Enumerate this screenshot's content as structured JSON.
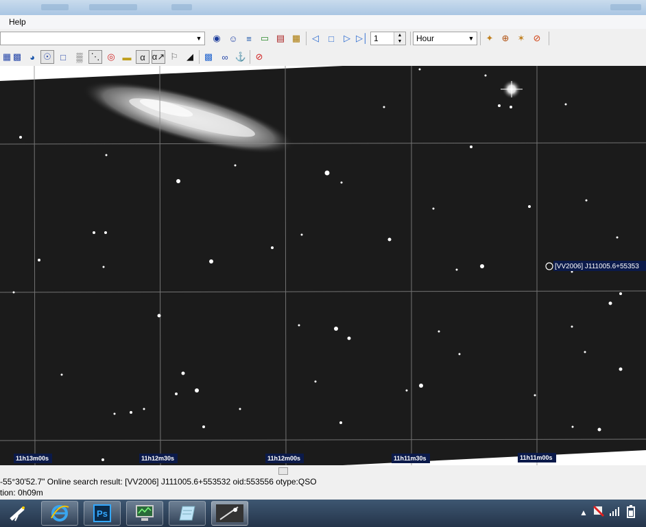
{
  "menu": {
    "help_label": "Help"
  },
  "toolbar": {
    "frame_value": "1",
    "time_unit": "Hour"
  },
  "sky": {
    "ra_labels": [
      "11h13m00s",
      "11h12m30s",
      "11h12m00s",
      "11h11m30s",
      "11h11m00s"
    ],
    "object_label": "[VV2006] J111005.6+55353"
  },
  "status": {
    "line1": "-55°30'52.7\"  Online search result: [VV2006] J111005.6+553532  oid:553556  otype:QSO",
    "line2": "tion:  0h09m"
  },
  "taskbar": {
    "apps": [
      "telescope-app",
      "internet-explorer",
      "photoshop",
      "monitor-app",
      "notepad-app",
      "sky-viewer"
    ],
    "ps_label": "Ps"
  },
  "colors": {
    "sky_background": "#1b1b1b",
    "grid": "#8a8a8a",
    "label_bg": "#0b1a4a",
    "taskbar": "#2f4560"
  }
}
